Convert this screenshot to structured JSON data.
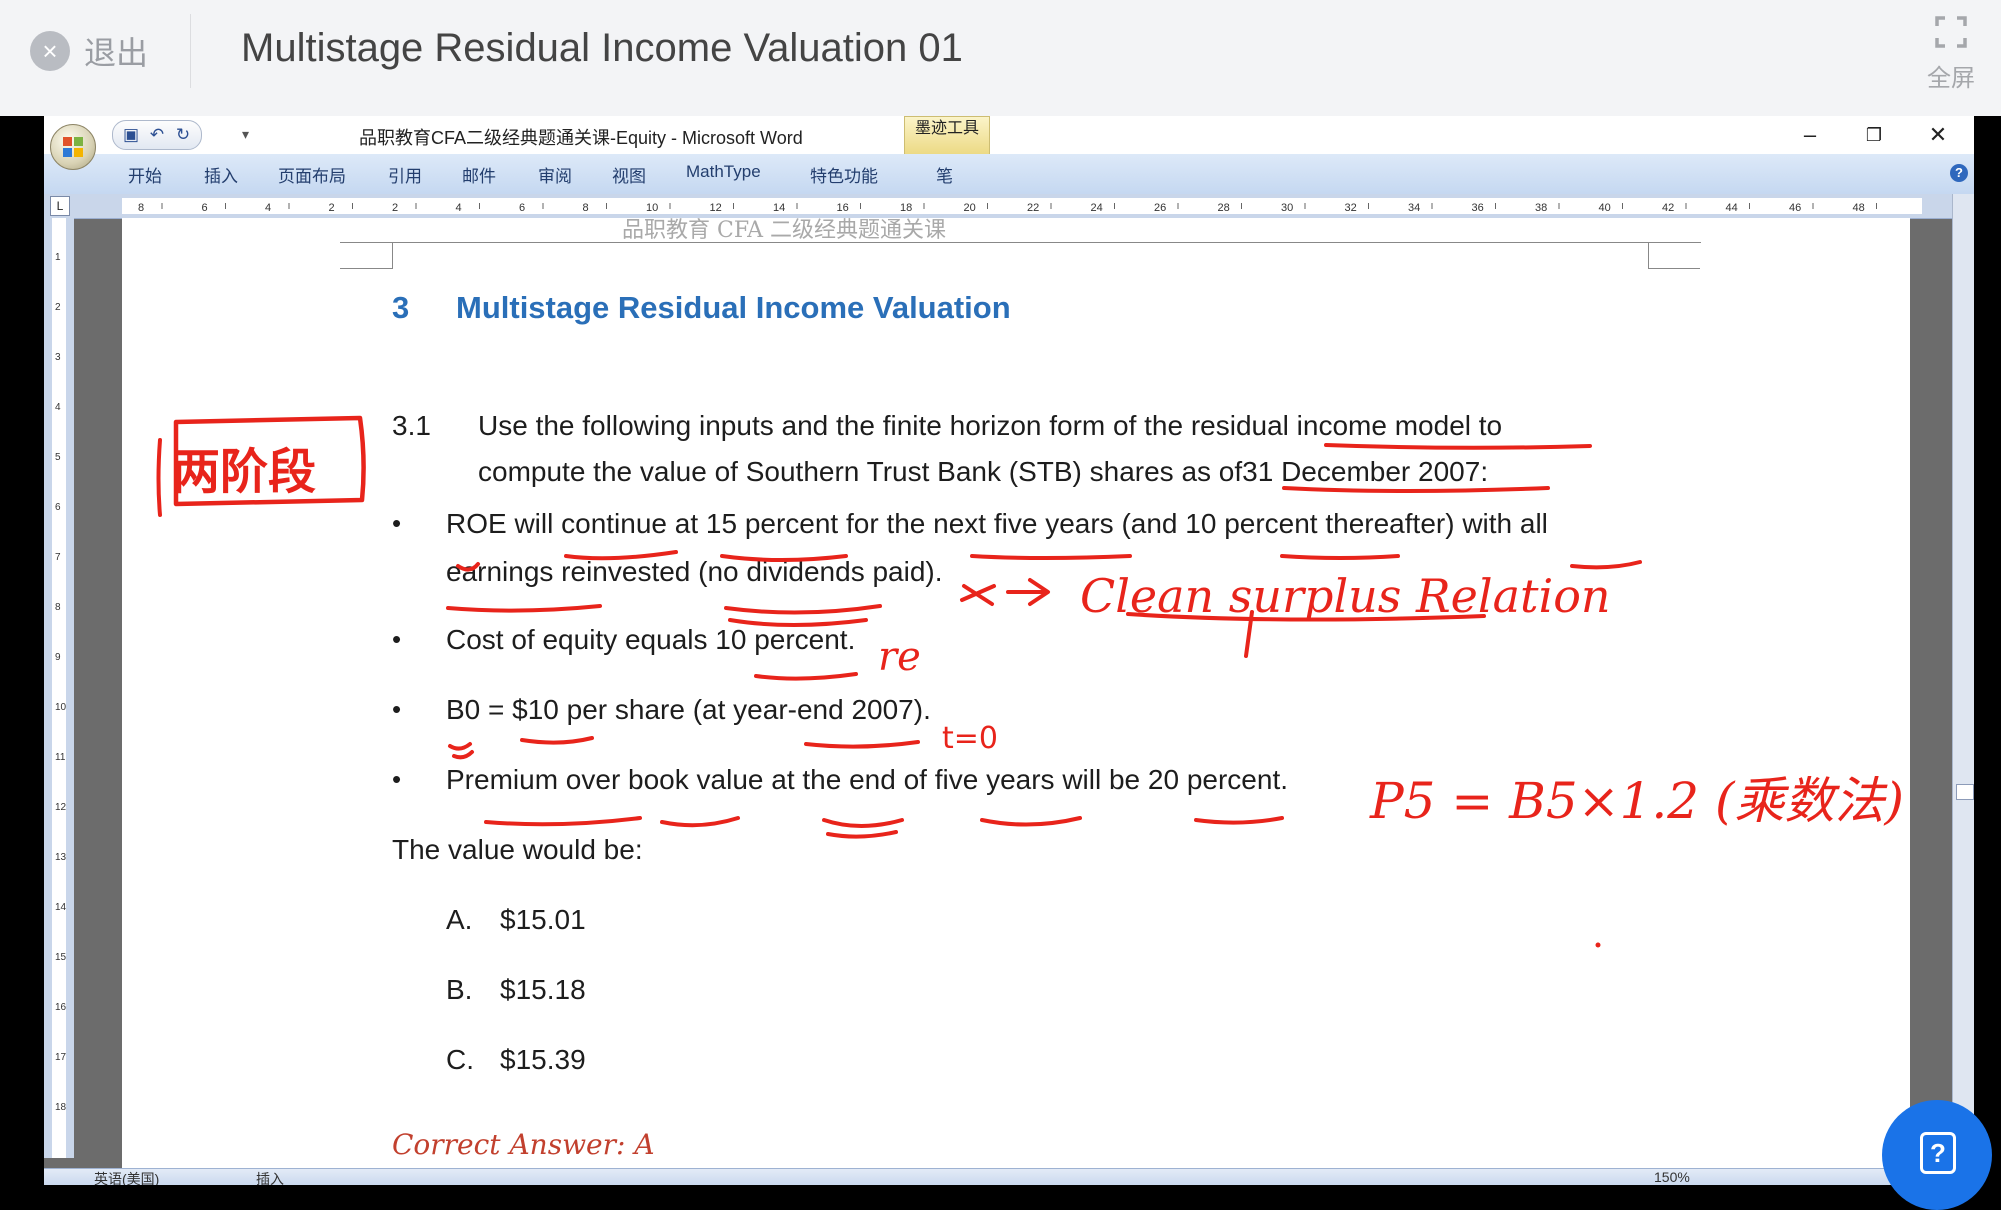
{
  "player": {
    "exit_label": "退出",
    "title": "Multistage Residual Income Valuation 01",
    "fullscreen_label": "全屏"
  },
  "word": {
    "window_title": "品职教育CFA二级经典题通关课-Equity - Microsoft Word",
    "contextual_tab": "墨迹工具",
    "ribbon_tabs": [
      "开始",
      "插入",
      "页面布局",
      "引用",
      "邮件",
      "审阅",
      "视图",
      "MathType",
      "特色功能",
      "笔"
    ],
    "ruler_marks": [
      "8",
      "6",
      "4",
      "2",
      "2",
      "4",
      "6",
      "8",
      "10",
      "12",
      "14",
      "16",
      "18",
      "20",
      "22",
      "24",
      "26",
      "28",
      "30",
      "32",
      "34",
      "36",
      "38",
      "40",
      "42",
      "44",
      "46",
      "48"
    ],
    "vruler_marks": [
      "1",
      "2",
      "3",
      "4",
      "5",
      "6",
      "7",
      "8",
      "9",
      "10",
      "11",
      "12",
      "13",
      "14",
      "15",
      "16",
      "17",
      "18"
    ],
    "status_language": "英语(美国)",
    "status_mode": "插入",
    "status_zoom": "150%"
  },
  "document": {
    "page_header": "品职教育 CFA 二级经典题通关课",
    "section_number": "3",
    "section_title": "Multistage Residual Income Valuation",
    "question_number": "3.1",
    "question_line1": "Use the following inputs and the finite horizon form of the residual income model to",
    "question_line2": "compute the value of Southern Trust Bank (STB) shares as of31 December 2007:",
    "bullets": [
      {
        "line1": "ROE will continue at 15 percent for the next five years (and 10 percent thereafter) with all",
        "line2": "earnings reinvested (no dividends paid)."
      },
      {
        "line1": "Cost of equity equals 10 percent.",
        "line2": ""
      },
      {
        "line1": "B0 = $10 per share (at year-end 2007).",
        "line2": ""
      },
      {
        "line1": "Premium over book value at the end of five years will be 20 percent.",
        "line2": ""
      }
    ],
    "value_prompt": "The value would be:",
    "options": [
      {
        "letter": "A.",
        "value": "$15.01"
      },
      {
        "letter": "B.",
        "value": "$15.18"
      },
      {
        "letter": "C.",
        "value": "$15.39"
      }
    ],
    "answer_label": "Correct Answer: A"
  },
  "annotations": {
    "ink_color": "#e8241b",
    "two_stage_note": "两阶段",
    "clean_surplus_note": "Clean surplus Relation",
    "re_note": "re",
    "time_point_note": "t=0",
    "p5_formula": "P5 = B5×1.2 (乘数法)"
  },
  "help_icon": "question-icon"
}
